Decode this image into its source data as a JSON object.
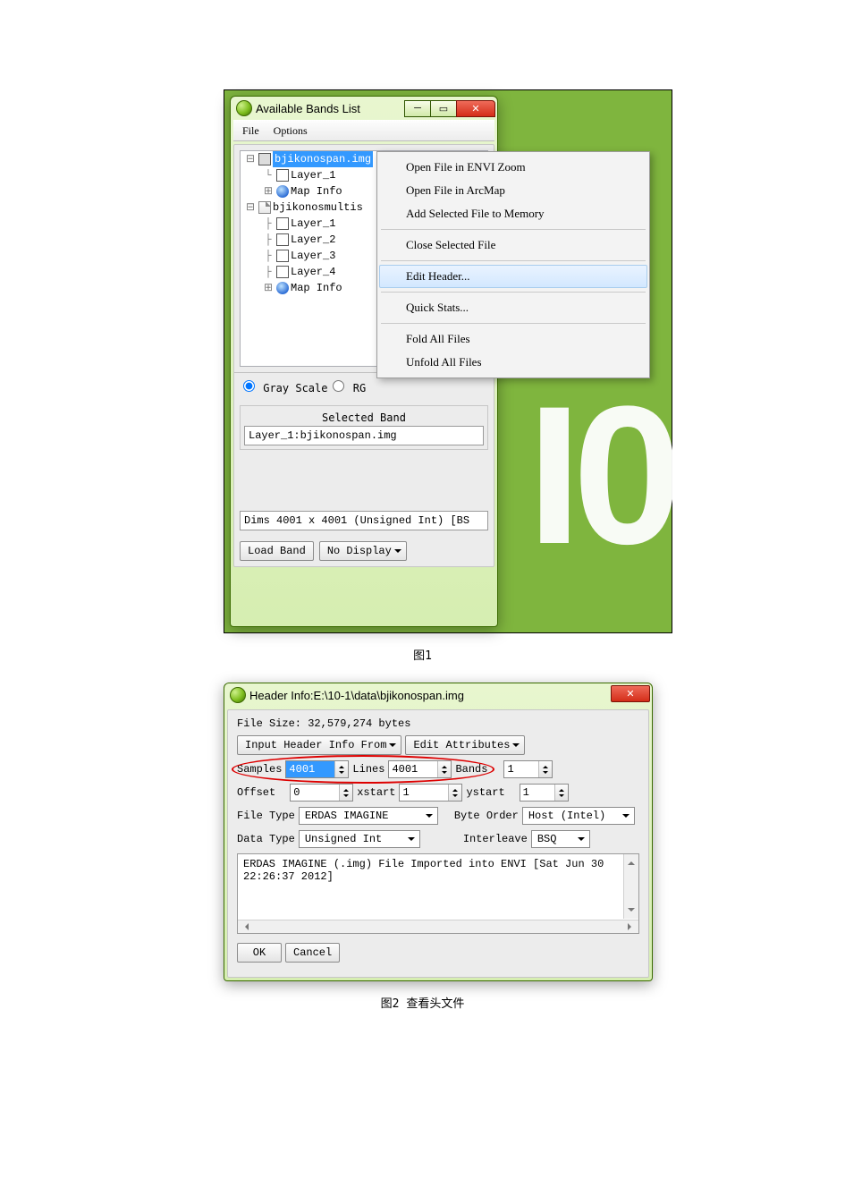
{
  "figure1_caption": "图1",
  "figure2_caption": "图2 查看头文件",
  "win1": {
    "title": "Available Bands List",
    "menu": {
      "file": "File",
      "options": "Options"
    },
    "tree": {
      "file1": "bjikonospan.img",
      "file1_layers": [
        "Layer_1"
      ],
      "file1_map": "Map Info",
      "file2": "bjikonosmultis",
      "file2_layers": [
        "Layer_1",
        "Layer_2",
        "Layer_3",
        "Layer_4"
      ],
      "file2_map": "Map Info"
    },
    "radio": {
      "gray": "Gray Scale",
      "rgb": "RG"
    },
    "selected_band_label": "Selected Band",
    "selected_band_value": "Layer_1:bjikonospan.img",
    "dims": "Dims 4001 x 4001 (Unsigned Int) [BS",
    "load_band": "Load Band",
    "no_display": "No Display"
  },
  "context_menu": {
    "open_zoom": "Open File in ENVI Zoom",
    "open_arcmap": "Open File in ArcMap",
    "add_memory": "Add Selected File to Memory",
    "close_selected": "Close Selected File",
    "edit_header": "Edit Header...",
    "quick_stats": "Quick Stats...",
    "fold": "Fold All Files",
    "unfold": "Unfold All Files"
  },
  "win2": {
    "title": "Header Info:E:\\10-1\\data\\bjikonospan.img",
    "file_size": "File Size: 32,579,274 bytes",
    "input_header_btn": "Input Header Info From",
    "edit_attr_btn": "Edit Attributes",
    "labels": {
      "samples": "Samples",
      "lines": "Lines",
      "bands": "Bands",
      "offset": "Offset",
      "xstart": "xstart",
      "ystart": "ystart",
      "file_type": "File Type",
      "byte_order": "Byte Order",
      "data_type": "Data Type",
      "interleave": "Interleave"
    },
    "values": {
      "samples": "4001",
      "lines": "4001",
      "bands": "1",
      "offset": "0",
      "xstart": "1",
      "ystart": "1",
      "file_type": "ERDAS IMAGINE",
      "byte_order": "Host (Intel)",
      "data_type": "Unsigned Int",
      "interleave": "BSQ"
    },
    "textarea": "ERDAS IMAGINE (.img) File Imported into ENVI [Sat Jun 30 22:26:37 2012]",
    "ok": "OK",
    "cancel": "Cancel"
  }
}
